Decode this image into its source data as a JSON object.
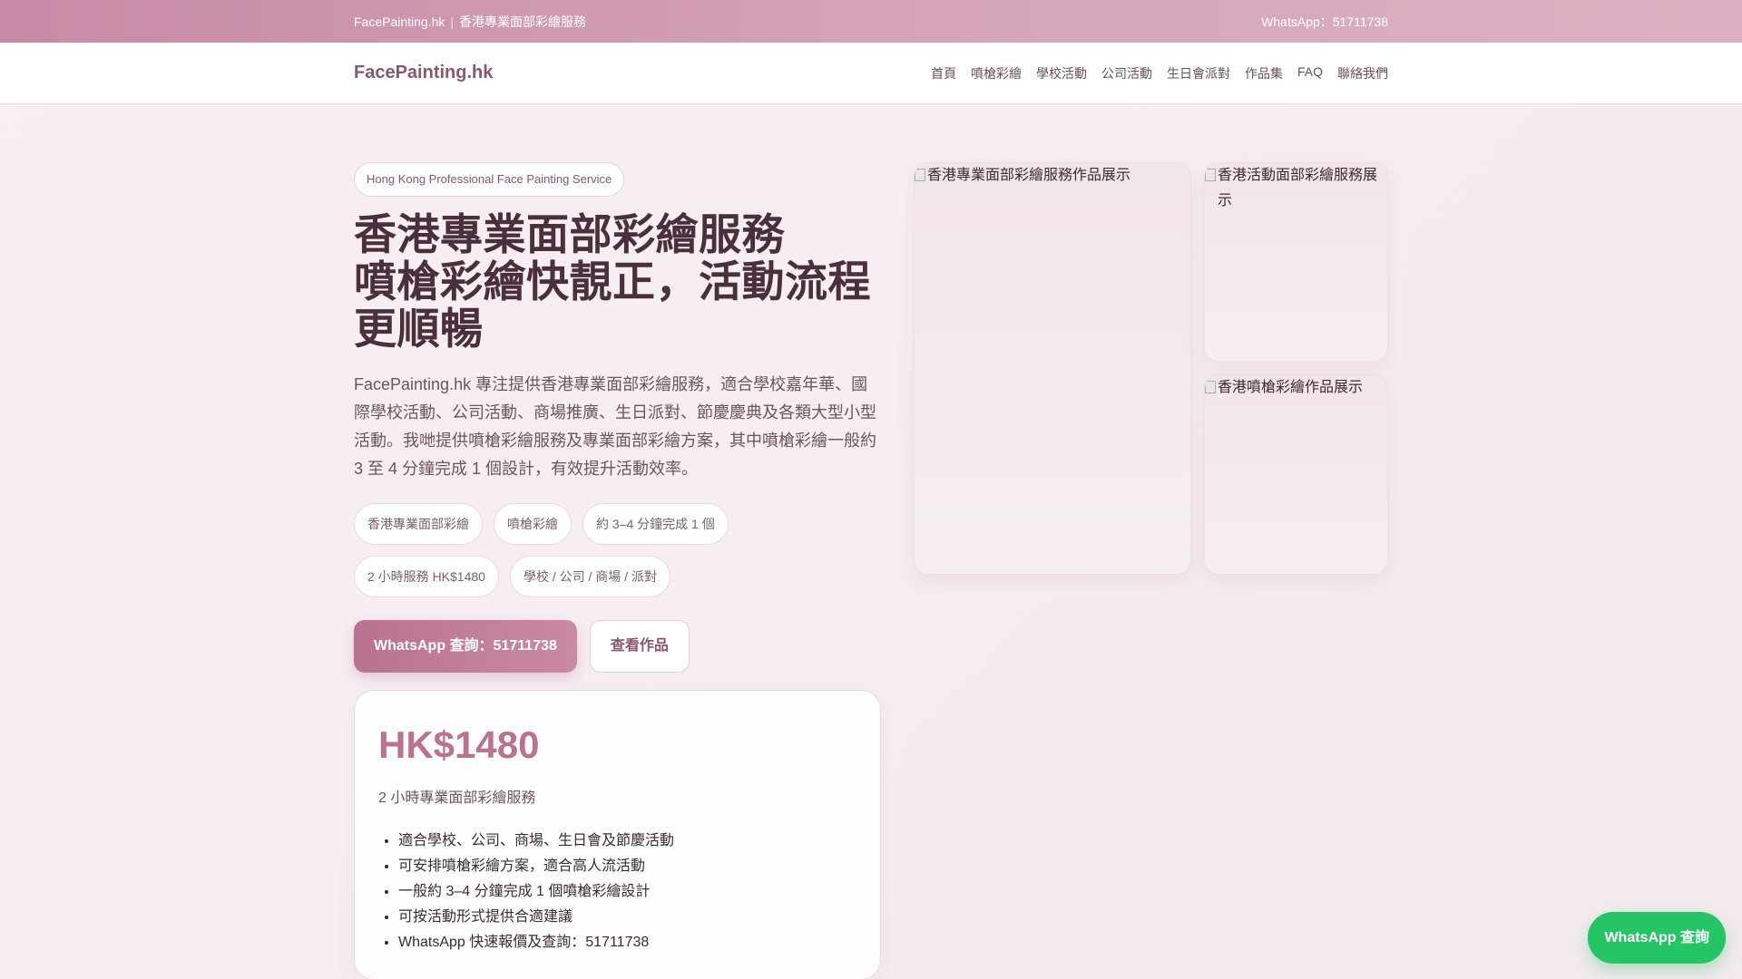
{
  "topbar": {
    "site": "FacePainting.hk",
    "separator": "|",
    "tagline": "香港專業面部彩繪服務",
    "contact": "WhatsApp：51711738"
  },
  "nav": {
    "brand": "FacePainting.hk",
    "items": [
      "首頁",
      "噴槍彩繪",
      "學校活動",
      "公司活動",
      "生日會派對",
      "作品集",
      "FAQ",
      "聯絡我們"
    ]
  },
  "hero": {
    "badge": "Hong Kong Professional Face Painting Service",
    "title_line1": "香港專業面部彩繪服務",
    "title_line2": "噴槍彩繪快靚正，活動流程",
    "title_line3": "更順暢",
    "description": "FacePainting.hk 專注提供香港專業面部彩繪服務，適合學校嘉年華、國際學校活動、公司活動、商場推廣、生日派對、節慶慶典及各類大型小型活動。我哋提供噴槍彩繪服務及專業面部彩繪方案，其中噴槍彩繪一般約 3 至 4 分鐘完成 1 個設計，有效提升活動效率。",
    "tags": [
      "香港專業面部彩繪",
      "噴槍彩繪",
      "約 3–4 分鐘完成 1 個",
      "2 小時服務 HK$1480",
      "學校 / 公司 / 商場 / 派對"
    ],
    "cta_primary": "WhatsApp 查詢：51711738",
    "cta_secondary": "查看作品"
  },
  "pricing": {
    "price": "HK$1480",
    "subtitle": "2 小時專業面部彩繪服務",
    "features": [
      "適合學校、公司、商場、生日會及節慶活動",
      "可安排噴槍彩繪方案，適合高人流活動",
      "一般約 3–4 分鐘完成 1 個噴槍彩繪設計",
      "可按活動形式提供合適建議",
      "WhatsApp 快速報價及查詢：51711738"
    ]
  },
  "gallery": {
    "main_alt": "香港專業面部彩繪服務作品展示",
    "side1_alt": "香港活動面部彩繪服務展示",
    "side2_alt": "香港噴槍彩繪作品展示"
  },
  "floating": {
    "whatsapp": "WhatsApp 查詢"
  },
  "colors": {
    "accent": "#b9728f",
    "brand": "#8b5670",
    "whatsapp": "#25c464"
  }
}
